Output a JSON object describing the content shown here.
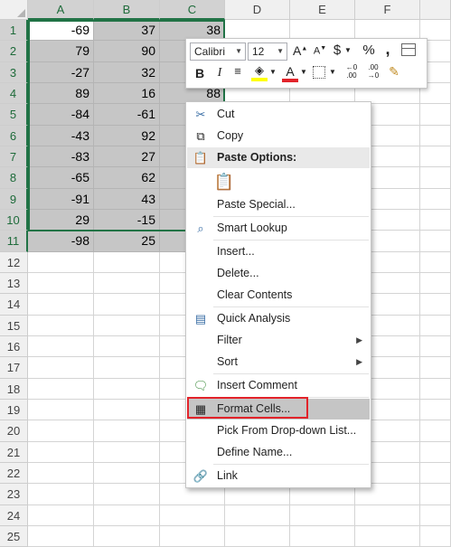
{
  "columns": [
    "A",
    "B",
    "C",
    "D",
    "E",
    "F"
  ],
  "rows": [
    "1",
    "2",
    "3",
    "4",
    "5",
    "6",
    "7",
    "8",
    "9",
    "10",
    "11",
    "12",
    "13",
    "14",
    "15",
    "16",
    "17",
    "18",
    "19",
    "20",
    "21",
    "22",
    "23",
    "24",
    "25"
  ],
  "cells": [
    [
      "-69",
      "37",
      "38"
    ],
    [
      "79",
      "90",
      ""
    ],
    [
      "-27",
      "32",
      ""
    ],
    [
      "89",
      "16",
      "88"
    ],
    [
      "-84",
      "-61",
      ""
    ],
    [
      "-43",
      "92",
      ""
    ],
    [
      "-83",
      "27",
      ""
    ],
    [
      "-65",
      "62",
      ""
    ],
    [
      "-91",
      "43",
      ""
    ],
    [
      "29",
      "-15",
      ""
    ],
    [
      "-98",
      "25",
      ""
    ]
  ],
  "mini_toolbar": {
    "font_name": "Calibri",
    "font_size": "12",
    "grow_font": "A",
    "shrink_font": "A",
    "currency": "$",
    "percent": "%",
    "comma": ",",
    "bold": "B",
    "italic": "I",
    "font_color": "A",
    "inc_decimal": ".00",
    "dec_decimal": ".00"
  },
  "context_menu": {
    "cut": "Cut",
    "copy": "Copy",
    "paste_options": "Paste Options:",
    "paste_special": "Paste Special...",
    "smart_lookup": "Smart Lookup",
    "insert": "Insert...",
    "delete": "Delete...",
    "clear_contents": "Clear Contents",
    "quick_analysis": "Quick Analysis",
    "filter": "Filter",
    "sort": "Sort",
    "insert_comment": "Insert Comment",
    "format_cells": "Format Cells...",
    "pick_from_list": "Pick From Drop-down List...",
    "define_name": "Define Name...",
    "link": "Link"
  },
  "colors": {
    "selection_border": "#217346",
    "highlight_red": "#e2232a",
    "font_color_bar": "#e2232a",
    "highlight_yellow": "#ffff00"
  }
}
